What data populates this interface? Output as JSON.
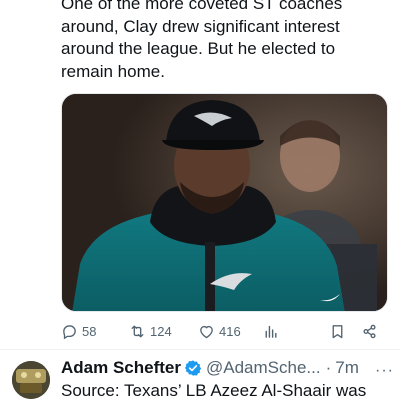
{
  "tweet": {
    "text_lines": [
      "One of the more coveted ST coaches",
      "around, Clay drew significant interest",
      "around the league. But he elected to",
      "remain home."
    ],
    "actions": {
      "replies": "58",
      "reposts": "124",
      "likes": "416"
    }
  },
  "next_tweet": {
    "author_name": "Adam Schefter",
    "handle": "@AdamSche...",
    "separator": "·",
    "time": "7m",
    "more": "···",
    "text": "Source: Texans’ LB Azeez Al-Shaair was"
  },
  "colors": {
    "text": "#0f1419",
    "secondary": "#536471",
    "verified": "#1d9bf0",
    "eagles_green": "#0b6e75"
  },
  "icons": [
    "reply-icon",
    "repost-icon",
    "like-icon",
    "views-icon",
    "bookmark-icon",
    "share-icon",
    "verified-badge-icon",
    "more-icon"
  ]
}
